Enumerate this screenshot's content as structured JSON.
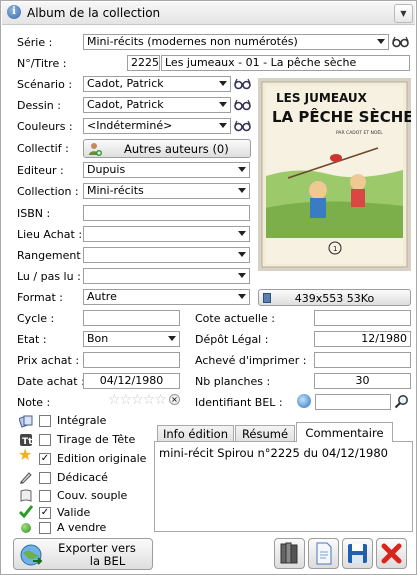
{
  "window": {
    "title": "Album de la collection"
  },
  "form": {
    "serie_label": "Série :",
    "serie_value": "Mini-récits (modernes non numérotés)",
    "num_label": "N°/Titre :",
    "num_value": "2225",
    "titre_value": "Les jumeaux - 01 - La pêche sèche",
    "scenario_label": "Scénario :",
    "scenario_value": "Cadot, Patrick",
    "dessin_label": "Dessin :",
    "dessin_value": "Cadot, Patrick",
    "couleurs_label": "Couleurs :",
    "couleurs_value": "<Indéterminé>",
    "collectif_label": "Collectif :",
    "autres_auteurs": "Autres auteurs (0)",
    "editeur_label": "Editeur :",
    "editeur_value": "Dupuis",
    "collection_label": "Collection :",
    "collection_value": "Mini-récits",
    "isbn_label": "ISBN :",
    "isbn_value": "",
    "lieu_achat_label": "Lieu Achat :",
    "lieu_achat_value": "",
    "rangement_label": "Rangement :",
    "rangement_value": "",
    "lu_label": "Lu / pas lu :",
    "lu_value": "",
    "format_label": "Format :",
    "format_value": "Autre",
    "image_info": "439x553 53Ko",
    "cycle_label": "Cycle :",
    "cycle_value": "",
    "cote_label": "Cote actuelle :",
    "cote_value": "",
    "etat_label": "Etat :",
    "etat_value": "Bon",
    "depot_label": "Dépôt Légal :",
    "depot_value": "12/1980",
    "prix_label": "Prix achat :",
    "prix_value": "",
    "acheve_label": "Achevé d'imprimer :",
    "acheve_value": "",
    "date_achat_label": "Date achat :",
    "date_achat_value": "04/12/1980",
    "planches_label": "Nb planches :",
    "planches_value": "30",
    "note_label": "Note :",
    "note_stars": 0,
    "identifiant_label": "Identifiant BEL :",
    "identifiant_value": ""
  },
  "cover": {
    "line1": "LES JUMEAUX",
    "line2": "LA PÊCHE SÈCHE",
    "credit": "PAR CADOT ET NOËL",
    "number": "1"
  },
  "checkboxes": [
    {
      "label": "Intégrale",
      "checked": false,
      "icon": "integrale-icon"
    },
    {
      "label": "Tirage de Tête",
      "checked": false,
      "icon": "tirage-icon"
    },
    {
      "label": "Edition originale",
      "checked": true,
      "icon": "star-icon"
    },
    {
      "label": "Dédicacé",
      "checked": false,
      "icon": "pen-icon"
    },
    {
      "label": "Couv. souple",
      "checked": false,
      "icon": "soft-cover-icon"
    },
    {
      "label": "Valide",
      "checked": true,
      "icon": "checkmark-icon"
    },
    {
      "label": "A vendre",
      "checked": false,
      "icon": "green-dot-icon"
    }
  ],
  "tabs": {
    "info_edition": "Info édition",
    "resume": "Résumé",
    "commentaire": "Commentaire",
    "active": "Commentaire",
    "commentaire_text": "mini-récit Spirou n°2225 du 04/12/1980"
  },
  "export_button": {
    "line1": "Exporter vers",
    "line2": "la BEL"
  },
  "colors": {
    "title_bg": "#e8e8e8",
    "border": "#a9a9a9",
    "delete_red": "#d9261c",
    "save_blue": "#1f5fb0"
  }
}
